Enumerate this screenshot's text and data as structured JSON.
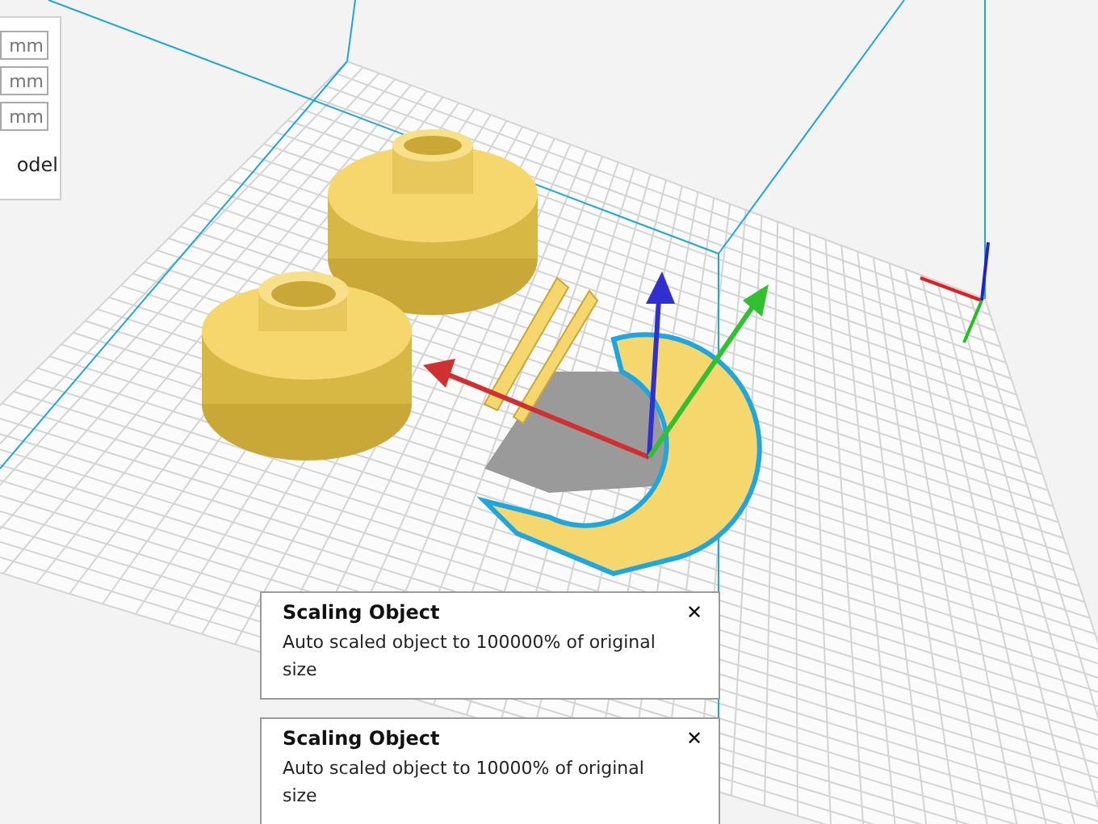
{
  "transform_panel": {
    "fields": [
      {
        "unit": "mm"
      },
      {
        "unit": "mm"
      },
      {
        "unit": "mm"
      }
    ],
    "option_label": "odel"
  },
  "notifications": [
    {
      "title": "Scaling Object",
      "message": "Auto scaled object to 100000% of original size",
      "close": "✕"
    },
    {
      "title": "Scaling Object",
      "message": "Auto scaled object to 10000% of original size",
      "close": "✕"
    }
  ]
}
